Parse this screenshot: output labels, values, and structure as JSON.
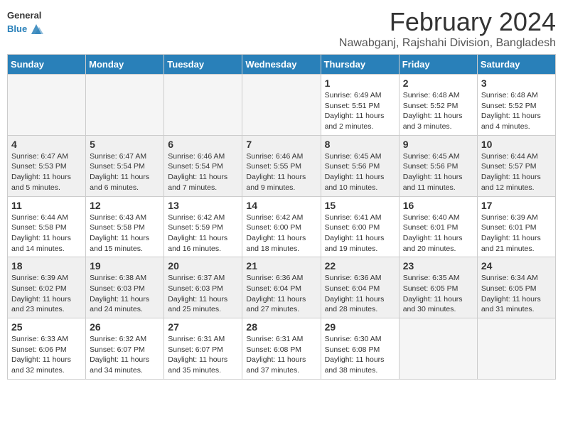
{
  "header": {
    "logo_general": "General",
    "logo_blue": "Blue",
    "title": "February 2024",
    "subtitle": "Nawabganj, Rajshahi Division, Bangladesh"
  },
  "calendar": {
    "days_of_week": [
      "Sunday",
      "Monday",
      "Tuesday",
      "Wednesday",
      "Thursday",
      "Friday",
      "Saturday"
    ],
    "weeks": [
      [
        {
          "date": "",
          "info": ""
        },
        {
          "date": "",
          "info": ""
        },
        {
          "date": "",
          "info": ""
        },
        {
          "date": "",
          "info": ""
        },
        {
          "date": "1",
          "info": "Sunrise: 6:49 AM\nSunset: 5:51 PM\nDaylight: 11 hours and 2 minutes."
        },
        {
          "date": "2",
          "info": "Sunrise: 6:48 AM\nSunset: 5:52 PM\nDaylight: 11 hours and 3 minutes."
        },
        {
          "date": "3",
          "info": "Sunrise: 6:48 AM\nSunset: 5:52 PM\nDaylight: 11 hours and 4 minutes."
        }
      ],
      [
        {
          "date": "4",
          "info": "Sunrise: 6:47 AM\nSunset: 5:53 PM\nDaylight: 11 hours and 5 minutes."
        },
        {
          "date": "5",
          "info": "Sunrise: 6:47 AM\nSunset: 5:54 PM\nDaylight: 11 hours and 6 minutes."
        },
        {
          "date": "6",
          "info": "Sunrise: 6:46 AM\nSunset: 5:54 PM\nDaylight: 11 hours and 7 minutes."
        },
        {
          "date": "7",
          "info": "Sunrise: 6:46 AM\nSunset: 5:55 PM\nDaylight: 11 hours and 9 minutes."
        },
        {
          "date": "8",
          "info": "Sunrise: 6:45 AM\nSunset: 5:56 PM\nDaylight: 11 hours and 10 minutes."
        },
        {
          "date": "9",
          "info": "Sunrise: 6:45 AM\nSunset: 5:56 PM\nDaylight: 11 hours and 11 minutes."
        },
        {
          "date": "10",
          "info": "Sunrise: 6:44 AM\nSunset: 5:57 PM\nDaylight: 11 hours and 12 minutes."
        }
      ],
      [
        {
          "date": "11",
          "info": "Sunrise: 6:44 AM\nSunset: 5:58 PM\nDaylight: 11 hours and 14 minutes."
        },
        {
          "date": "12",
          "info": "Sunrise: 6:43 AM\nSunset: 5:58 PM\nDaylight: 11 hours and 15 minutes."
        },
        {
          "date": "13",
          "info": "Sunrise: 6:42 AM\nSunset: 5:59 PM\nDaylight: 11 hours and 16 minutes."
        },
        {
          "date": "14",
          "info": "Sunrise: 6:42 AM\nSunset: 6:00 PM\nDaylight: 11 hours and 18 minutes."
        },
        {
          "date": "15",
          "info": "Sunrise: 6:41 AM\nSunset: 6:00 PM\nDaylight: 11 hours and 19 minutes."
        },
        {
          "date": "16",
          "info": "Sunrise: 6:40 AM\nSunset: 6:01 PM\nDaylight: 11 hours and 20 minutes."
        },
        {
          "date": "17",
          "info": "Sunrise: 6:39 AM\nSunset: 6:01 PM\nDaylight: 11 hours and 21 minutes."
        }
      ],
      [
        {
          "date": "18",
          "info": "Sunrise: 6:39 AM\nSunset: 6:02 PM\nDaylight: 11 hours and 23 minutes."
        },
        {
          "date": "19",
          "info": "Sunrise: 6:38 AM\nSunset: 6:03 PM\nDaylight: 11 hours and 24 minutes."
        },
        {
          "date": "20",
          "info": "Sunrise: 6:37 AM\nSunset: 6:03 PM\nDaylight: 11 hours and 25 minutes."
        },
        {
          "date": "21",
          "info": "Sunrise: 6:36 AM\nSunset: 6:04 PM\nDaylight: 11 hours and 27 minutes."
        },
        {
          "date": "22",
          "info": "Sunrise: 6:36 AM\nSunset: 6:04 PM\nDaylight: 11 hours and 28 minutes."
        },
        {
          "date": "23",
          "info": "Sunrise: 6:35 AM\nSunset: 6:05 PM\nDaylight: 11 hours and 30 minutes."
        },
        {
          "date": "24",
          "info": "Sunrise: 6:34 AM\nSunset: 6:05 PM\nDaylight: 11 hours and 31 minutes."
        }
      ],
      [
        {
          "date": "25",
          "info": "Sunrise: 6:33 AM\nSunset: 6:06 PM\nDaylight: 11 hours and 32 minutes."
        },
        {
          "date": "26",
          "info": "Sunrise: 6:32 AM\nSunset: 6:07 PM\nDaylight: 11 hours and 34 minutes."
        },
        {
          "date": "27",
          "info": "Sunrise: 6:31 AM\nSunset: 6:07 PM\nDaylight: 11 hours and 35 minutes."
        },
        {
          "date": "28",
          "info": "Sunrise: 6:31 AM\nSunset: 6:08 PM\nDaylight: 11 hours and 37 minutes."
        },
        {
          "date": "29",
          "info": "Sunrise: 6:30 AM\nSunset: 6:08 PM\nDaylight: 11 hours and 38 minutes."
        },
        {
          "date": "",
          "info": ""
        },
        {
          "date": "",
          "info": ""
        }
      ]
    ]
  }
}
